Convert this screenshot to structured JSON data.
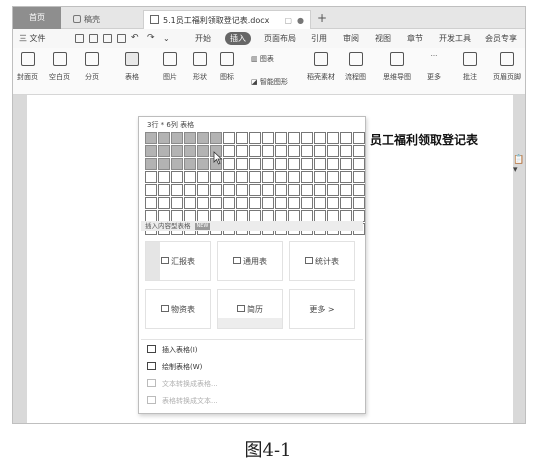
{
  "tabs": {
    "home": "首页",
    "shell": "稿壳",
    "document": "5.1员工福利领取登记表.docx",
    "new_tab": "+"
  },
  "menu": {
    "file": "三 文件",
    "items": [
      "开始",
      "插入",
      "页面布局",
      "引用",
      "审阅",
      "视图",
      "章节",
      "开发工具",
      "会员专享"
    ],
    "active": "插入"
  },
  "ribbon": {
    "cover": "封面页",
    "blank": "空白页",
    "page_break": "分页",
    "table": "表格",
    "picture": "图片",
    "shape": "形状",
    "icon": "图标",
    "chart": "图表",
    "smart_art": "智能图形",
    "material": "稻壳素材",
    "flowchart": "流程图",
    "mind_map": "思维导图",
    "more": "更多",
    "comment": "批注",
    "header_footer": "页眉页脚"
  },
  "document": {
    "title": "员工福利领取登记表"
  },
  "table_dropdown": {
    "size_label": "3行 * 6列 表格",
    "rows": 8,
    "cols": 17,
    "selected_rows": 3,
    "selected_cols": 6,
    "template_header": "插入内容型表格",
    "template_tag": "NEW",
    "templates": [
      "汇报表",
      "通用表",
      "统计表",
      "物资表",
      "简历",
      "更多 >"
    ],
    "commands": [
      {
        "label": "插入表格(I)",
        "enabled": true
      },
      {
        "label": "绘制表格(W)",
        "enabled": true
      },
      {
        "label": "文本转换成表格...",
        "enabled": false
      },
      {
        "label": "表格转换成文本...",
        "enabled": false
      }
    ]
  },
  "caption": "图4-1"
}
